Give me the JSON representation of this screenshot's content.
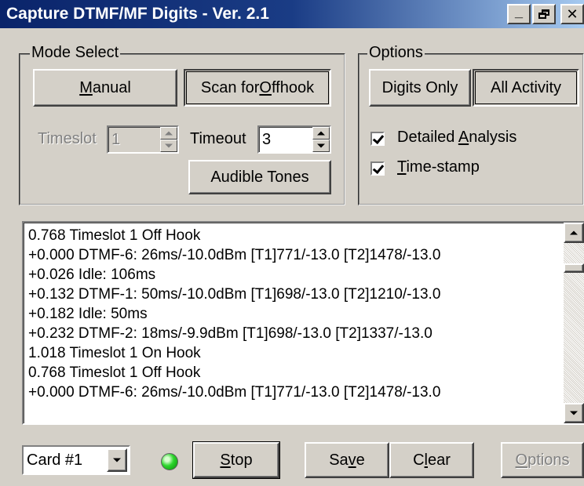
{
  "window": {
    "title": "Capture DTMF/MF Digits - Ver. 2.1",
    "minimize_glyph": "_",
    "restore_glyph": "🗗",
    "close_glyph": "✕"
  },
  "mode_select": {
    "title": "Mode Select",
    "manual_label_pre": "",
    "manual_label_ul": "M",
    "manual_label_post": "anual",
    "scan_label_pre": "Scan for ",
    "scan_label_ul": "O",
    "scan_label_post": "ffhook",
    "timeslot_label": "Timeslot",
    "timeslot_value": "1",
    "timeout_label": "Timeout",
    "timeout_value": "3",
    "audible_tones_label": "Audible Tones"
  },
  "options": {
    "title": "Options",
    "digits_only_label": "Digits Only",
    "all_activity_label": "All Activity",
    "detailed_analysis_pre": "Detailed ",
    "detailed_analysis_ul": "A",
    "detailed_analysis_post": "nalysis",
    "detailed_analysis_checked": true,
    "timestamp_ul": "T",
    "timestamp_post": "ime-stamp",
    "timestamp_checked": true
  },
  "log": {
    "lines": [
      "0.768 Timeslot 1 Off Hook",
      "+0.000 DTMF-6: 26ms/-10.0dBm  [T1]771/-13.0  [T2]1478/-13.0",
      "+0.026 Idle: 106ms",
      "+0.132 DTMF-1: 50ms/-10.0dBm  [T1]698/-13.0  [T2]1210/-13.0",
      "+0.182 Idle: 50ms",
      "+0.232 DTMF-2: 18ms/-9.9dBm  [T1]698/-13.0  [T2]1337/-13.0",
      "1.018 Timeslot 1 On Hook",
      "0.768 Timeslot 1 Off Hook",
      "+0.000 DTMF-6: 26ms/-10.0dBm  [T1]771/-13.0  [T2]1478/-13.0"
    ]
  },
  "footer": {
    "card_value": "Card #1",
    "stop_ul": "S",
    "stop_post": "top",
    "save_pre": "Sa",
    "save_ul": "v",
    "save_post": "e",
    "clear_pre": "C",
    "clear_ul": "l",
    "clear_post": "ear",
    "options_ul": "O",
    "options_post": "ptions"
  },
  "colors": {
    "titlebar_start": "#0a246a",
    "titlebar_end": "#a6caf0",
    "face": "#d4d0c8",
    "led_on": "#2dd62d"
  }
}
